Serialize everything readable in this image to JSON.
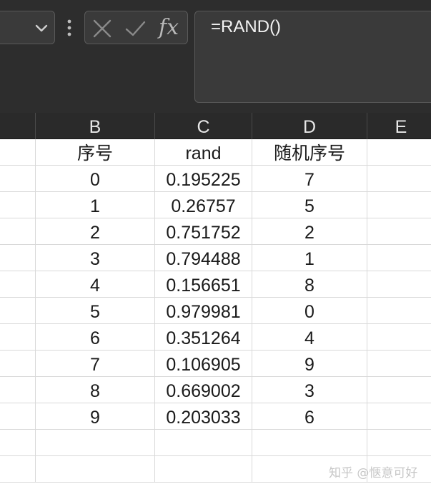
{
  "formula_bar": {
    "formula": "=RAND()",
    "fx_label": "fx"
  },
  "columns": [
    "B",
    "C",
    "D",
    "E"
  ],
  "header_row": {
    "b": "序号",
    "c": "rand",
    "d": "随机序号"
  },
  "rows": [
    {
      "b": "0",
      "c": "0.195225",
      "d": "7"
    },
    {
      "b": "1",
      "c": "0.26757",
      "d": "5"
    },
    {
      "b": "2",
      "c": "0.751752",
      "d": "2"
    },
    {
      "b": "3",
      "c": "0.794488",
      "d": "1"
    },
    {
      "b": "4",
      "c": "0.156651",
      "d": "8"
    },
    {
      "b": "5",
      "c": "0.979981",
      "d": "0"
    },
    {
      "b": "6",
      "c": "0.351264",
      "d": "4"
    },
    {
      "b": "7",
      "c": "0.106905",
      "d": "9"
    },
    {
      "b": "8",
      "c": "0.669002",
      "d": "3"
    },
    {
      "b": "9",
      "c": "0.203033",
      "d": "6"
    }
  ],
  "watermark": "知乎 @惬意可好"
}
